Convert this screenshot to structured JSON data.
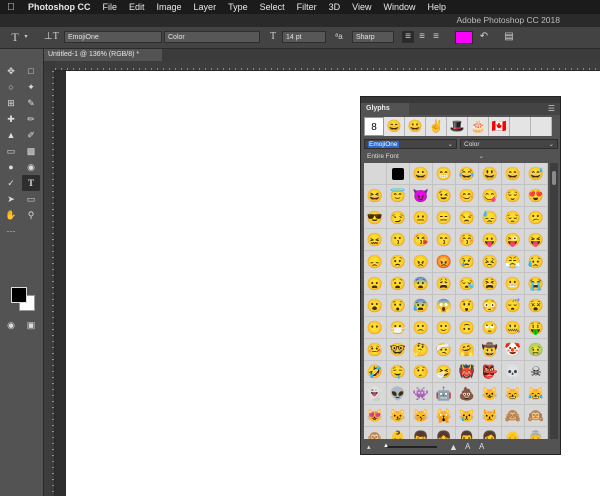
{
  "menubar": {
    "apple_icon": "apple-icon",
    "items": [
      "Photoshop CC",
      "File",
      "Edit",
      "Image",
      "Layer",
      "Type",
      "Select",
      "Filter",
      "3D",
      "View",
      "Window",
      "Help"
    ]
  },
  "titlebar": {
    "title": "Adobe Photoshop CC 2018"
  },
  "options": {
    "font_family": "EmojiOne",
    "font_style": "Color",
    "font_size": "14 pt",
    "aa_label": "ªa",
    "antialias": "Sharp",
    "color_swatch": "#ff00ff"
  },
  "document": {
    "tab_title": "Untitled-1 @ 136% (RGB/8) *"
  },
  "glyphs_panel": {
    "title": "Glyphs",
    "recent": [
      "8",
      "😄",
      "😀",
      "✌",
      "🎩",
      "🎂",
      "🇨🇦"
    ],
    "font_value": "EmojiOne",
    "style_value": "Color",
    "filter_value": "Entire Font",
    "grid": [
      "",
      "■",
      "😀",
      "😁",
      "😂",
      "😃",
      "😄",
      "😅",
      "😆",
      "😇",
      "😈",
      "😉",
      "😊",
      "😋",
      "😌",
      "😍",
      "😎",
      "😏",
      "😐",
      "😑",
      "😒",
      "😓",
      "😔",
      "😕",
      "😖",
      "😗",
      "😘",
      "😙",
      "😚",
      "😛",
      "😜",
      "😝",
      "😞",
      "😟",
      "😠",
      "😡",
      "😢",
      "😣",
      "😤",
      "😥",
      "😦",
      "😧",
      "😨",
      "😩",
      "😪",
      "😫",
      "😬",
      "😭",
      "😮",
      "😯",
      "😰",
      "😱",
      "😲",
      "😳",
      "😴",
      "😵",
      "😶",
      "😷",
      "🙁",
      "🙂",
      "🙃",
      "🙄",
      "🤐",
      "🤑",
      "🤒",
      "🤓",
      "🤔",
      "🤕",
      "🤗",
      "🤠",
      "🤡",
      "🤢",
      "🤣",
      "🤤",
      "🤥",
      "🤧",
      "👹",
      "👺",
      "💀",
      "☠",
      "👻",
      "👽",
      "👾",
      "🤖",
      "💩",
      "😺",
      "😸",
      "😹",
      "😻",
      "😼",
      "😽",
      "🙀",
      "😿",
      "😾",
      "🙈",
      "🙉",
      "🙊",
      "👶",
      "👦",
      "👧",
      "👨",
      "👩",
      "👴",
      "👵"
    ]
  },
  "colors": {
    "accent_magenta": "#ff00ff",
    "selection_blue": "#2e67c4"
  }
}
